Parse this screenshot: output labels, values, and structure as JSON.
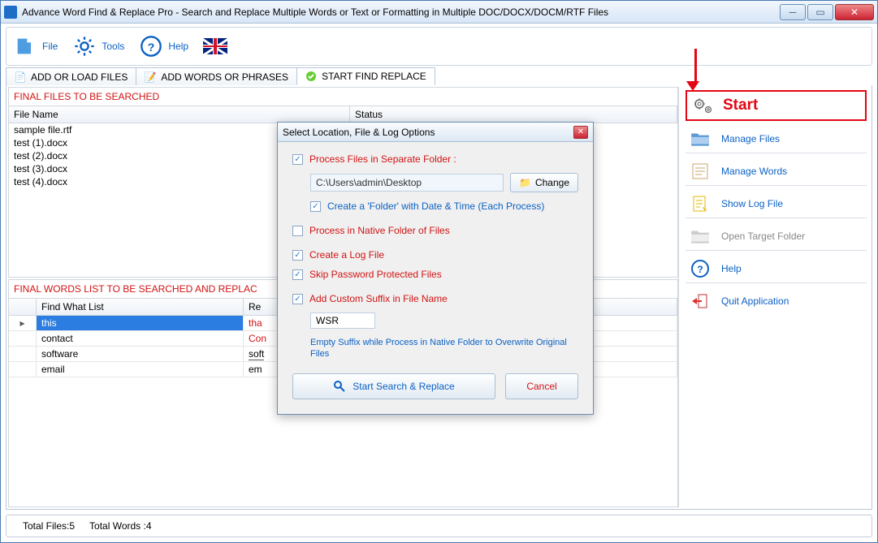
{
  "window": {
    "title": "Advance Word Find & Replace Pro - Search and Replace Multiple Words or Text  or Formatting in Multiple DOC/DOCX/DOCM/RTF Files"
  },
  "menubar": {
    "file": "File",
    "tools": "Tools",
    "help": "Help"
  },
  "tabs": {
    "t1": "ADD OR LOAD FILES",
    "t2": "ADD WORDS OR PHRASES",
    "t3": "START FIND REPLACE"
  },
  "files_panel": {
    "title": "FINAL FILES TO BE SEARCHED",
    "col1": "File Name",
    "col2": "Status",
    "rows": [
      "sample file.rtf",
      "test (1).docx",
      "test (2).docx",
      "test (3).docx",
      "test (4).docx"
    ]
  },
  "words_panel": {
    "title": "FINAL WORDS LIST TO BE SEARCHED AND REPLAC",
    "col1": "Find What List",
    "col2": "Re",
    "rows": [
      {
        "find": "this",
        "replace": "tha",
        "red": true,
        "sel": true
      },
      {
        "find": "contact",
        "replace": "Con",
        "red": true
      },
      {
        "find": "software",
        "replace": "soft",
        "underline": true
      },
      {
        "find": "email",
        "replace": "em"
      }
    ]
  },
  "sidebar": {
    "start": "Start",
    "manage_files": "Manage Files",
    "manage_words": "Manage Words",
    "show_log": "Show Log File",
    "open_target": "Open Target Folder",
    "help": "Help",
    "quit": "Quit Application"
  },
  "dialog": {
    "title": "Select Location, File & Log Options",
    "process_separate": "Process Files in Separate Folder :",
    "path": "C:\\Users\\admin\\Desktop",
    "change": "Change",
    "create_folder": "Create a 'Folder' with Date & Time (Each Process)",
    "process_native": "Process in Native Folder of Files",
    "create_log": "Create a Log File",
    "skip_pwd": "Skip Password Protected Files",
    "add_suffix": "Add Custom Suffix in File Name",
    "suffix": "WSR",
    "hint": "Empty Suffix while Process in Native Folder to Overwrite Original Files",
    "start_btn": "Start Search & Replace",
    "cancel": "Cancel"
  },
  "footer": {
    "total_files": "Total Files:5",
    "total_words": "Total Words :4"
  }
}
